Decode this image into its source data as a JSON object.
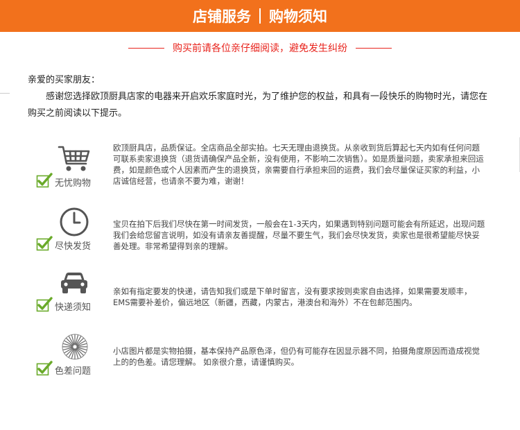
{
  "banner": {
    "left": "店铺服务",
    "right": "购物须知"
  },
  "subtitle": "购买前请各位亲仔细阅读，避免发生纠纷",
  "intro": {
    "greeting": "亲爱的买家朋友：",
    "body": "感谢您选择欧顶厨具店家的电器来开启欢乐家庭时光，为了维护您的权益，和具有一段快乐的购物时光，请您在购买之前阅读以下提示。"
  },
  "sections": [
    {
      "icon": "shopping-cart-icon",
      "label": "无忧购物",
      "text": "欧顶厨具店，品质保证。全店商品全部实拍。七天无理由退换货。从亲收到货后算起七天内如有任何问题可联系卖家退换货（退货请确保产品全新，没有使用，不影响二次销售）。如是质量问题，卖家承担来回运费，如是颜色或个人因素而产生的退换货，亲需要自行承担来回的运费，我们会尽量保证买家的利益，小店诚信经营，也请亲不要为难，谢谢！"
    },
    {
      "icon": "clock-icon",
      "label": "尽快发货",
      "text": "宝贝在拍下后我们尽快在第一时间发货，一般会在1-3天内，如果遇到特别问题可能会有所延迟，出现问题我们会给您留言说明，如没有请亲友善提醒，尽量不要生气，我们会尽快发货，卖家也是很希望能尽快妥善处理。非常希望得到亲的理解。"
    },
    {
      "icon": "car-icon",
      "label": "快递须知",
      "text": "亲如有指定要发的快递，请告知我们或是下单时留言，没有要求按则卖家自由选择，如果需要发顺丰，EMS需要补差价，偏远地区（新疆，西藏，内蒙古，港澳台和海外）不在包邮范围内。"
    },
    {
      "icon": "color-wheel-icon",
      "label": "色差问题",
      "text": "小店图片都是实物拍摄，基本保持产品原色泽，但仍有可能存在因显示器不同，拍摄角度原因而造成视觉上的的色差。请您理解。 如亲很介意，请谨慎购买。"
    }
  ],
  "colors": {
    "accent": "#f2711c",
    "warning": "#e8231c",
    "check": "#6aaa2a",
    "icon": "#555555"
  }
}
